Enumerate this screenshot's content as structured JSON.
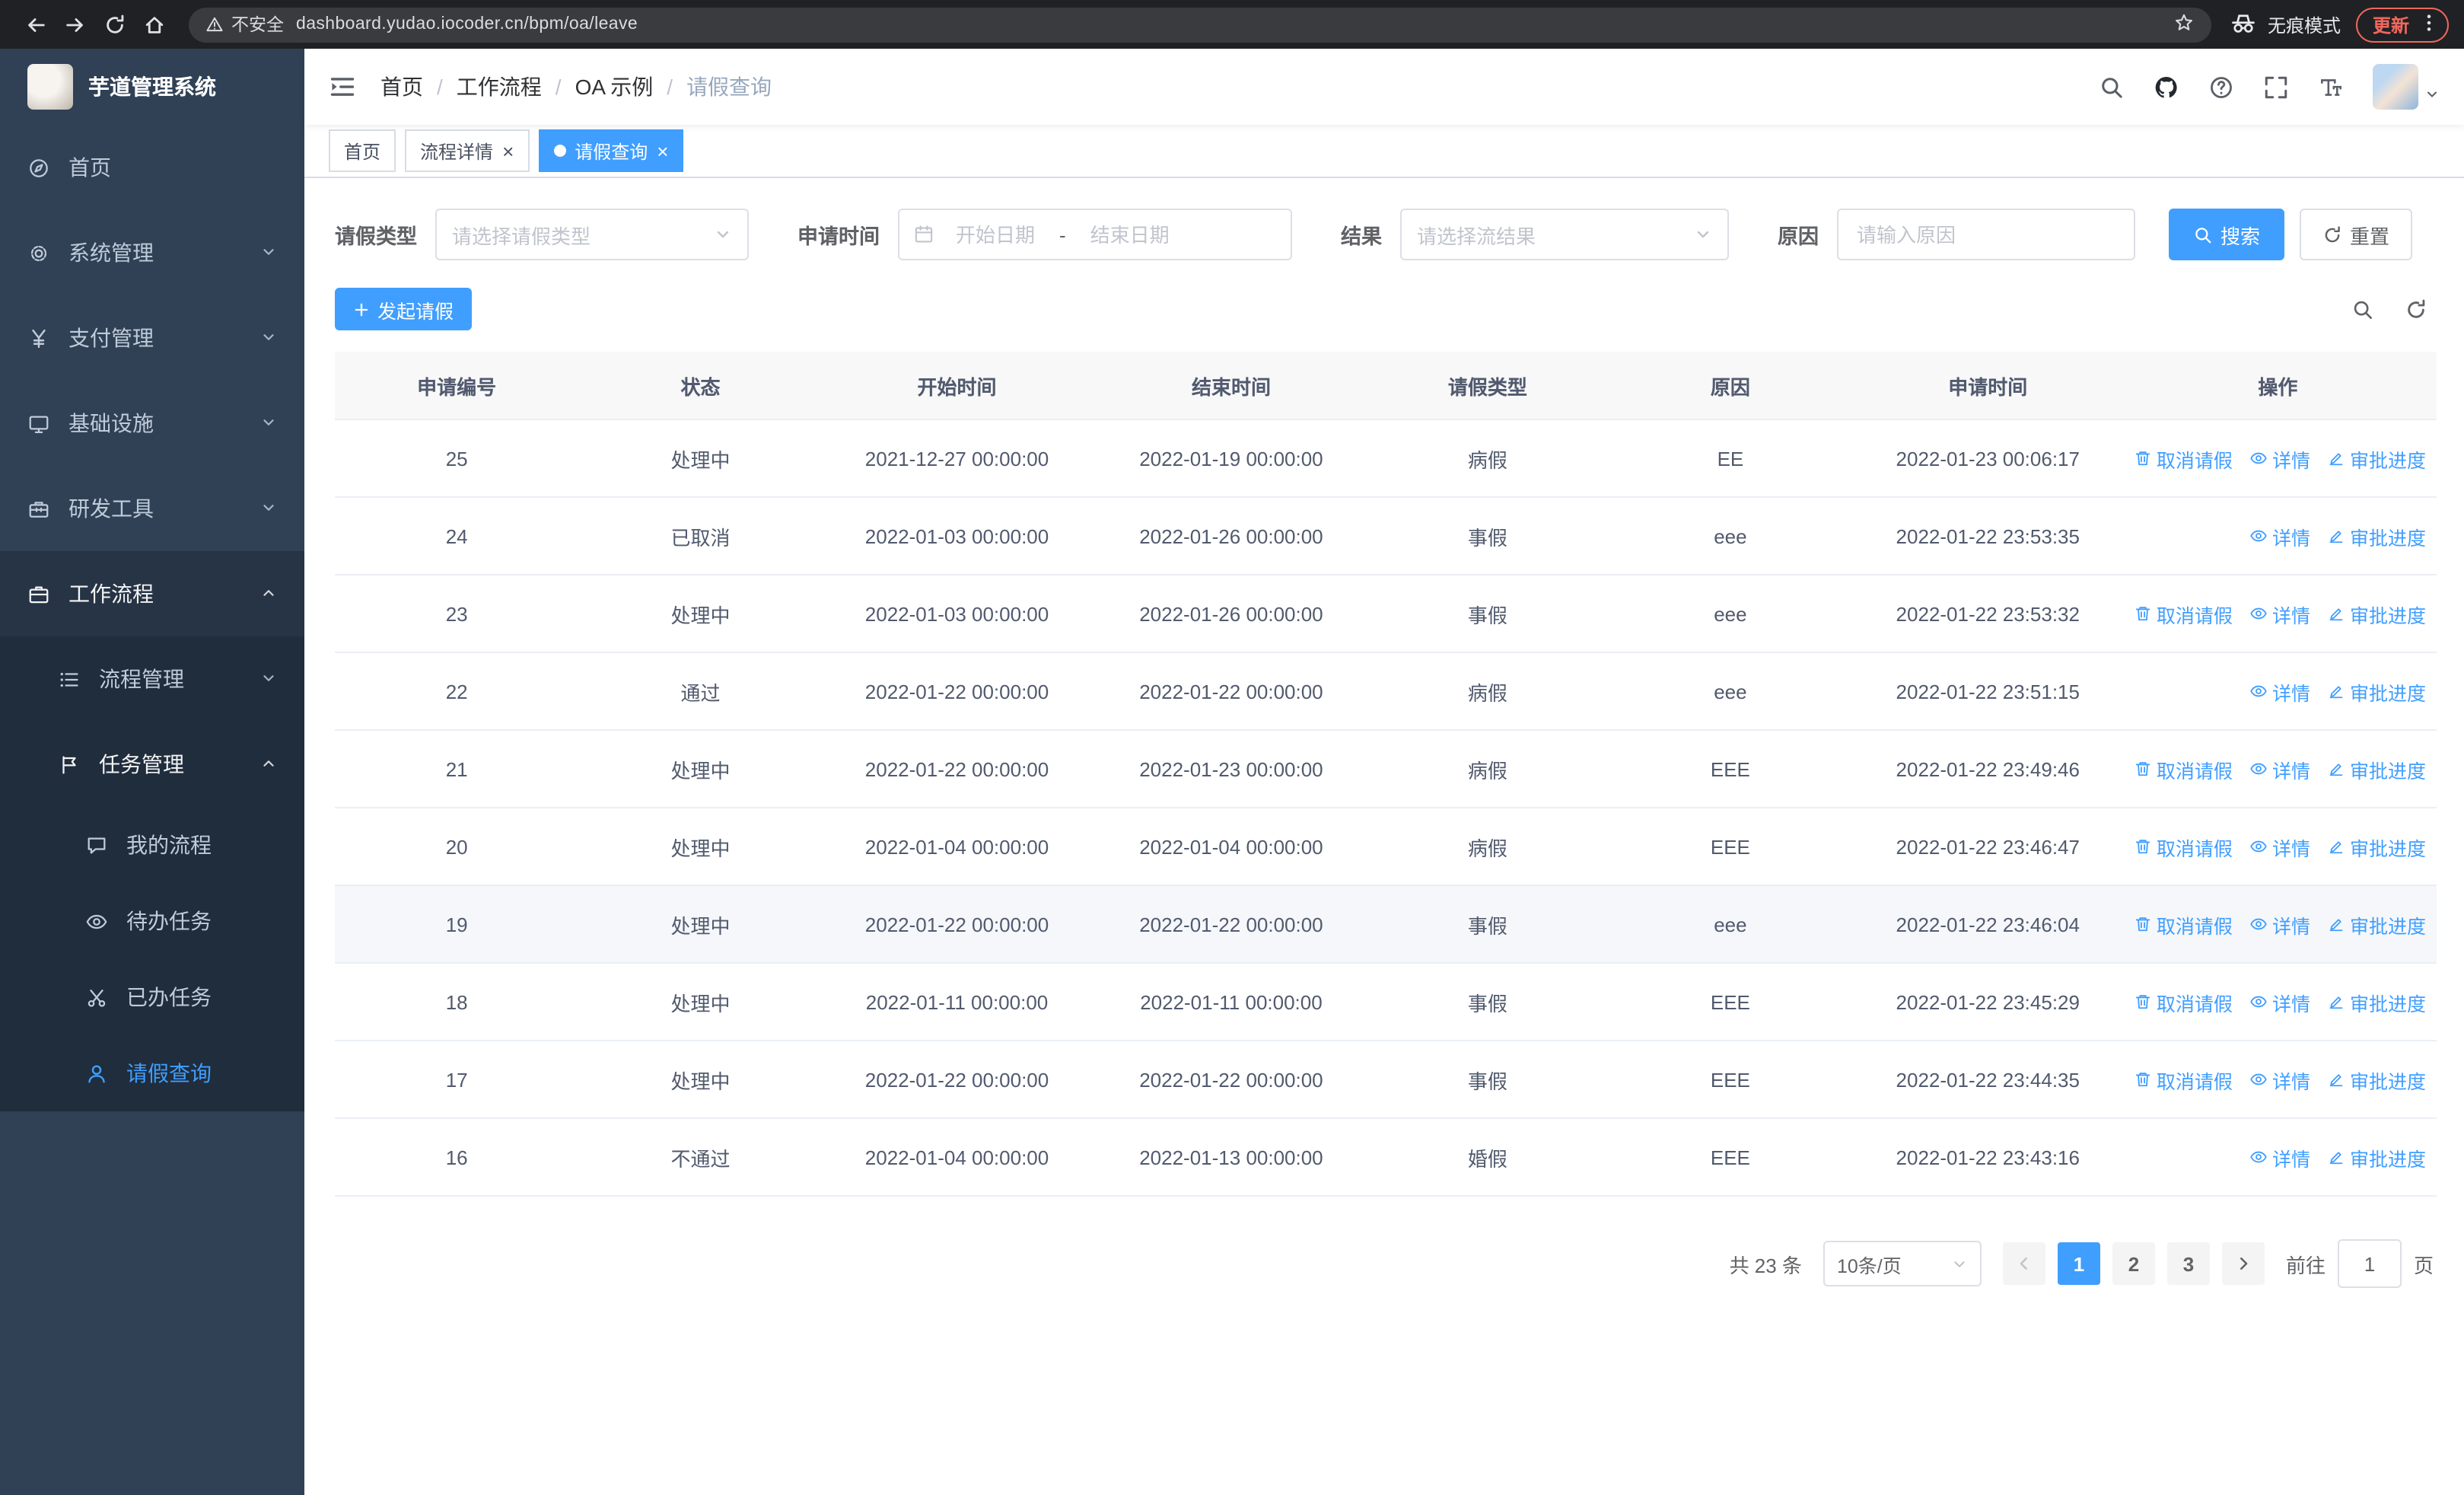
{
  "colors": {
    "primary": "#409EFF",
    "sidebar_bg": "#304156",
    "submenu_bg": "#1f2d3d",
    "update_accent": "#ee675c"
  },
  "browser": {
    "security": "不安全",
    "url": "dashboard.yudao.iocoder.cn/bpm/oa/leave",
    "incognito": "无痕模式",
    "update": "更新"
  },
  "icons": {
    "close": "×",
    "breadcrumb_separator": "/"
  },
  "sidebar": {
    "title": "芋道管理系统",
    "items": [
      {
        "label": "首页"
      },
      {
        "label": "系统管理"
      },
      {
        "label": "支付管理"
      },
      {
        "label": "基础设施"
      },
      {
        "label": "研发工具"
      },
      {
        "label": "工作流程"
      }
    ],
    "workflow_children": [
      {
        "label": "流程管理"
      },
      {
        "label": "任务管理"
      }
    ],
    "task_children": [
      {
        "label": "我的流程"
      },
      {
        "label": "待办任务"
      },
      {
        "label": "已办任务"
      },
      {
        "label": "请假查询"
      }
    ]
  },
  "breadcrumb": {
    "items": [
      "首页",
      "工作流程",
      "OA 示例",
      "请假查询"
    ]
  },
  "tabs": [
    {
      "label": "首页"
    },
    {
      "label": "流程详情"
    },
    {
      "label": "请假查询"
    }
  ],
  "filters": {
    "leave_type": {
      "label": "请假类型",
      "placeholder": "请选择请假类型"
    },
    "apply_time": {
      "label": "申请时间",
      "start_placeholder": "开始日期",
      "separator": "-",
      "end_placeholder": "结束日期"
    },
    "result": {
      "label": "结果",
      "placeholder": "请选择流结果"
    },
    "reason": {
      "label": "原因",
      "placeholder": "请输入原因"
    },
    "search": "搜索",
    "reset": "重置"
  },
  "toolbar": {
    "create": "发起请假"
  },
  "table": {
    "headers": [
      "申请编号",
      "状态",
      "开始时间",
      "结束时间",
      "请假类型",
      "原因",
      "申请时间",
      "操作"
    ],
    "actions": {
      "cancel": "取消请假",
      "detail": "详情",
      "progress": "审批进度"
    },
    "rows": [
      {
        "id": "25",
        "status": "处理中",
        "start": "2021-12-27 00:00:00",
        "end": "2022-01-19 00:00:00",
        "type": "病假",
        "reason": "EE",
        "applied": "2022-01-23 00:06:17"
      },
      {
        "id": "24",
        "status": "已取消",
        "start": "2022-01-03 00:00:00",
        "end": "2022-01-26 00:00:00",
        "type": "事假",
        "reason": "eee",
        "applied": "2022-01-22 23:53:35"
      },
      {
        "id": "23",
        "status": "处理中",
        "start": "2022-01-03 00:00:00",
        "end": "2022-01-26 00:00:00",
        "type": "事假",
        "reason": "eee",
        "applied": "2022-01-22 23:53:32"
      },
      {
        "id": "22",
        "status": "通过",
        "start": "2022-01-22 00:00:00",
        "end": "2022-01-22 00:00:00",
        "type": "病假",
        "reason": "eee",
        "applied": "2022-01-22 23:51:15"
      },
      {
        "id": "21",
        "status": "处理中",
        "start": "2022-01-22 00:00:00",
        "end": "2022-01-23 00:00:00",
        "type": "病假",
        "reason": "EEE",
        "applied": "2022-01-22 23:49:46"
      },
      {
        "id": "20",
        "status": "处理中",
        "start": "2022-01-04 00:00:00",
        "end": "2022-01-04 00:00:00",
        "type": "病假",
        "reason": "EEE",
        "applied": "2022-01-22 23:46:47"
      },
      {
        "id": "19",
        "status": "处理中",
        "start": "2022-01-22 00:00:00",
        "end": "2022-01-22 00:00:00",
        "type": "事假",
        "reason": "eee",
        "applied": "2022-01-22 23:46:04"
      },
      {
        "id": "18",
        "status": "处理中",
        "start": "2022-01-11 00:00:00",
        "end": "2022-01-11 00:00:00",
        "type": "事假",
        "reason": "EEE",
        "applied": "2022-01-22 23:45:29"
      },
      {
        "id": "17",
        "status": "处理中",
        "start": "2022-01-22 00:00:00",
        "end": "2022-01-22 00:00:00",
        "type": "事假",
        "reason": "EEE",
        "applied": "2022-01-22 23:44:35"
      },
      {
        "id": "16",
        "status": "不通过",
        "start": "2022-01-04 00:00:00",
        "end": "2022-01-13 00:00:00",
        "type": "婚假",
        "reason": "EEE",
        "applied": "2022-01-22 23:43:16"
      }
    ]
  },
  "pagination": {
    "total": "共 23 条",
    "page_size": "10条/页",
    "pages": [
      "1",
      "2",
      "3"
    ],
    "goto_label": "前往",
    "goto_value": "1",
    "page_unit": "页"
  }
}
